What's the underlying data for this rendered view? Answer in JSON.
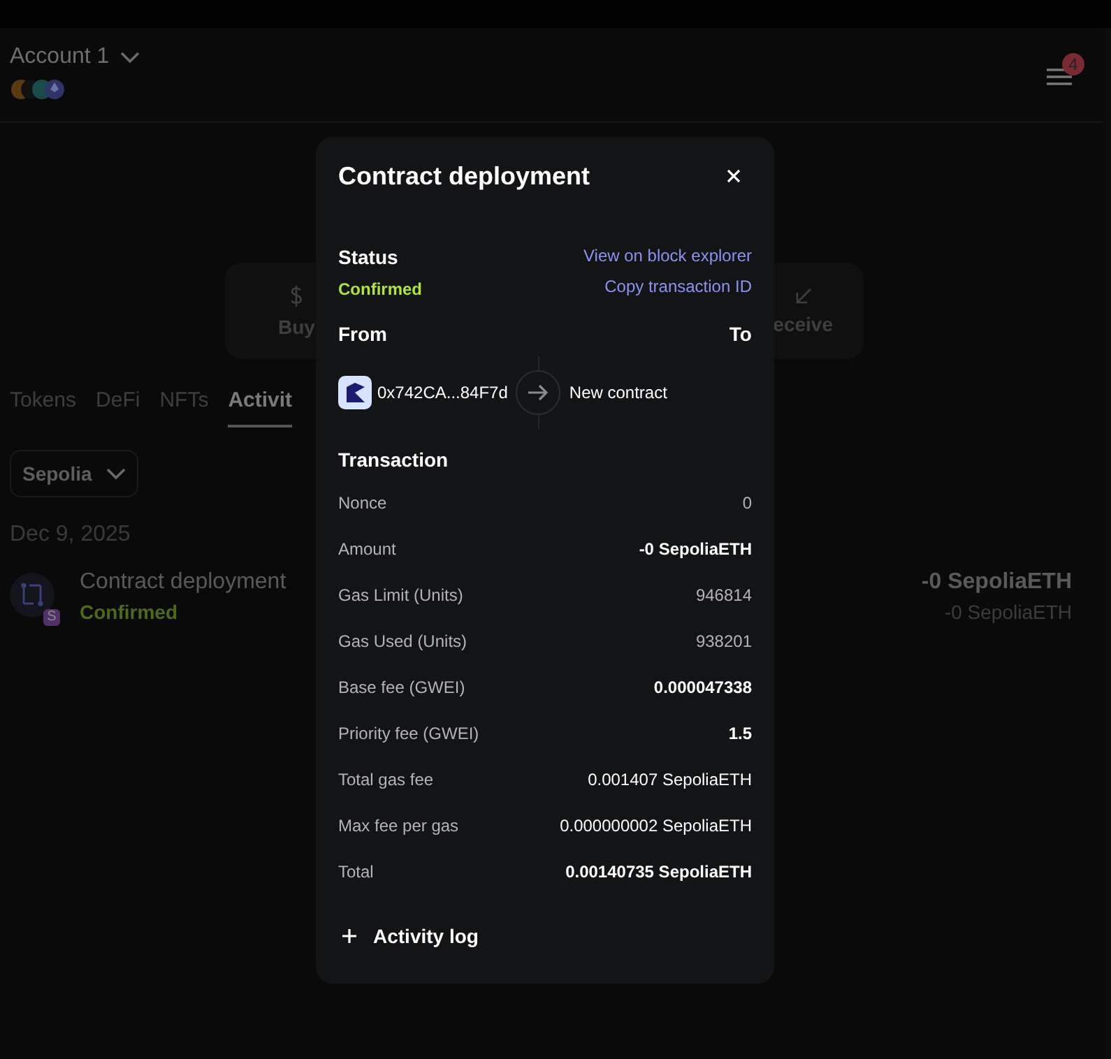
{
  "header": {
    "account": "Account 1",
    "notifications": "4"
  },
  "actions": [
    {
      "label": "Buy",
      "kind": "buy"
    },
    {
      "label": "eceive",
      "kind": "receive"
    }
  ],
  "tabs": [
    {
      "label": "Tokens",
      "selected": false
    },
    {
      "label": "DeFi",
      "selected": false
    },
    {
      "label": "NFTs",
      "selected": false
    },
    {
      "label": "Activit",
      "selected": true
    }
  ],
  "network_filter": "Sepolia",
  "activity": {
    "date": "Dec 9, 2025",
    "items": [
      {
        "title": "Contract deployment",
        "status": "Confirmed",
        "badge": "S",
        "amount": "-0 SepoliaETH",
        "fiat": "-0 SepoliaETH"
      }
    ]
  },
  "modal": {
    "title": "Contract deployment",
    "status_label": "Status",
    "status": "Confirmed",
    "links": [
      "View on block explorer",
      "Copy transaction ID"
    ],
    "from_label": "From",
    "to_label": "To",
    "from": "0x742CA...84F7d",
    "to": "New contract",
    "transaction_label": "Transaction",
    "rows": [
      {
        "label": "Nonce",
        "value": "0",
        "kind": "muted"
      },
      {
        "label": "Amount",
        "value": "-0 SepoliaETH",
        "kind": "strong"
      },
      {
        "label": "Gas Limit (Units)",
        "value": "946814",
        "kind": "muted"
      },
      {
        "label": "Gas Used (Units)",
        "value": "938201",
        "kind": "muted"
      },
      {
        "label": "Base fee (GWEI)",
        "value": "0.000047338",
        "kind": "strong"
      },
      {
        "label": "Priority fee (GWEI)",
        "value": "1.5",
        "kind": "strong"
      },
      {
        "label": "Total gas fee",
        "value": "0.001407 SepoliaETH",
        "kind": "plain"
      },
      {
        "label": "Max fee per gas",
        "value": "0.000000002 SepoliaETH",
        "kind": "plain"
      },
      {
        "label": "Total",
        "value": "0.00140735 SepoliaETH",
        "kind": "strong"
      }
    ],
    "log_label": "Activity log"
  }
}
